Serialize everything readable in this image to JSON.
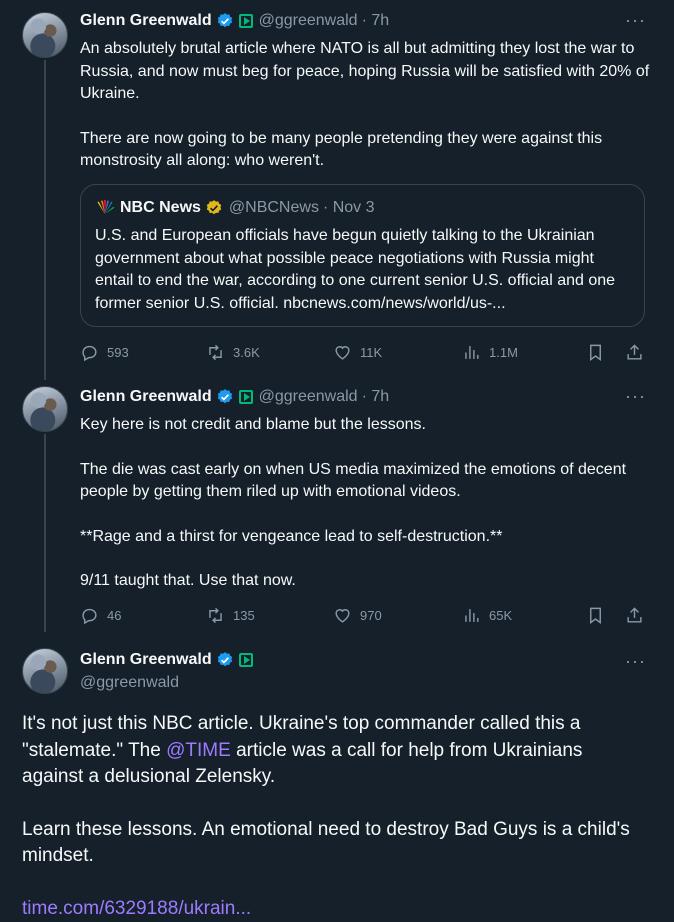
{
  "tweets": [
    {
      "author_name": "Glenn Greenwald",
      "handle": "@ggreenwald",
      "time": "· 7h",
      "text_p1": "An absolutely brutal article where NATO is all but admitting they lost the war to Russia, and now must beg for peace, hoping Russia will be satisfied with 20% of Ukraine.",
      "text_p2": "There are now going to be many people pretending they were against this monstrosity all along: who weren't.",
      "quote": {
        "author_name": "NBC News",
        "handle": "@NBCNews",
        "time": "· Nov 3",
        "text": "U.S. and European officials have begun quietly talking to the Ukrainian government about what possible peace negotiations with Russia might entail to end the war, according to one current senior U.S. official and one former senior U.S. official.  nbcnews.com/news/world/us-..."
      },
      "replies": "593",
      "reposts": "3.6K",
      "likes": "11K",
      "views": "1.1M"
    },
    {
      "author_name": "Glenn Greenwald",
      "handle": "@ggreenwald",
      "time": "· 7h",
      "text_p1": "Key here is not credit and blame but the lessons.",
      "text_p2": "The die was cast early on when US media maximized the emotions of decent people by getting them riled up with emotional videos.",
      "text_p3": "**Rage and a thirst for vengeance lead to self-destruction.**",
      "text_p4": "9/11 taught that. Use that now.",
      "replies": "46",
      "reposts": "135",
      "likes": "970",
      "views": "65K"
    },
    {
      "author_name": "Glenn Greenwald",
      "handle": "@ggreenwald",
      "text_p1_a": "It's not just this NBC article. Ukraine's top commander called this a \"stalemate.\" The ",
      "mention": "@TIME",
      "text_p1_b": " article was a call for help from Ukrainians against a delusional Zelensky.",
      "text_p2": "Learn these lessons. An emotional need to destroy Bad Guys is a child's mindset.",
      "link": "time.com/6329188/ukrain..."
    }
  ],
  "colors": {
    "background": "#15202b",
    "text": "#f7f9f9",
    "muted": "#8b98a5",
    "verified": "#1d9bf0",
    "gold": "#e2b719",
    "link": "#9d7bff",
    "border": "#38444d"
  }
}
